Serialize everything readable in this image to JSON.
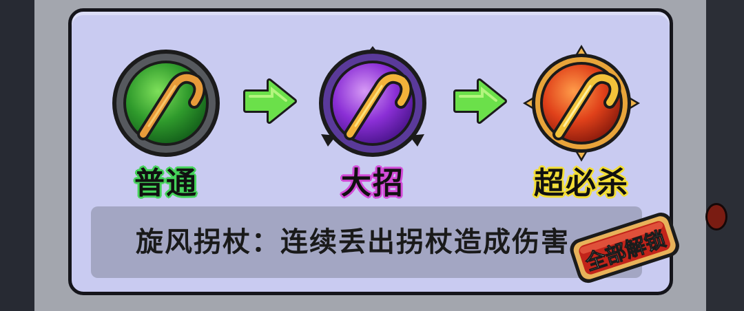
{
  "skills": [
    {
      "name": "普通",
      "tier": "normal",
      "icon": "green-cane-orb-icon"
    },
    {
      "name": "大招",
      "tier": "ultimate",
      "icon": "purple-cane-orb-icon"
    },
    {
      "name": "超必杀",
      "tier": "super",
      "icon": "orange-cane-orb-icon"
    }
  ],
  "description": "旋风拐杖：连续丢出拐杖造成伤害",
  "unlock_badge": "全部解锁",
  "colors": {
    "card_bg": "#c9cbf1",
    "desc_bg": "#a3a6c3",
    "normal_outline": "#45d35a",
    "ultimate_outline": "#d34bd8",
    "super_outline": "#f3de35",
    "arrow": "#6be04a",
    "badge_red": "#c2241a",
    "badge_gold": "#e8b25a"
  }
}
